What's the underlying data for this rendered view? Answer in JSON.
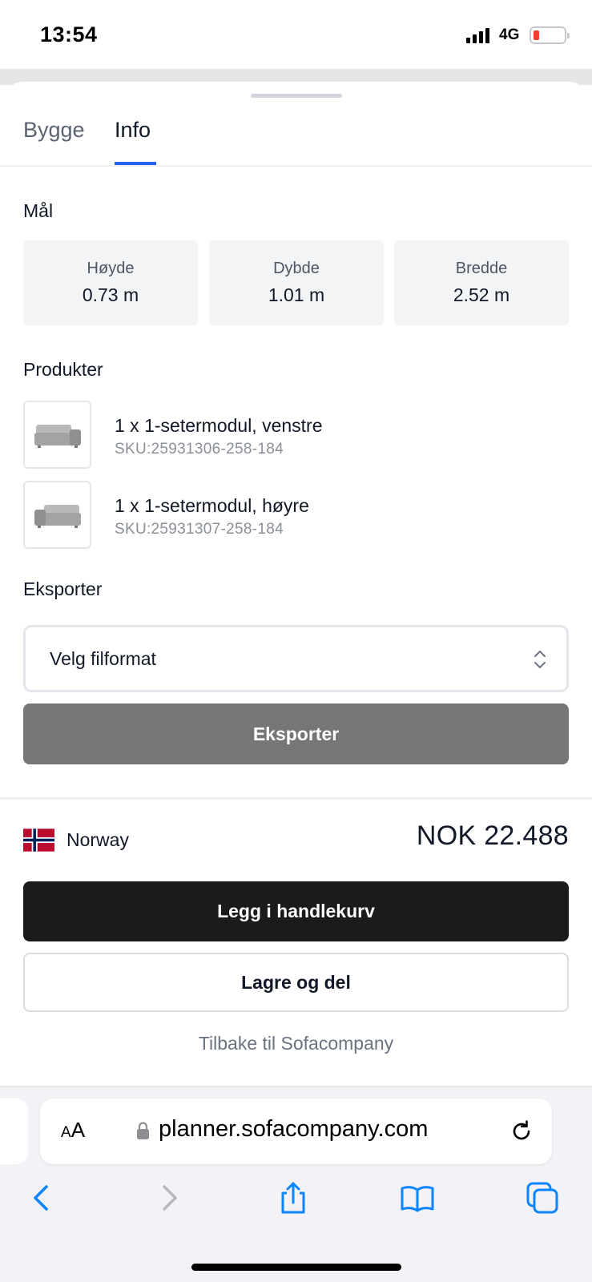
{
  "status_bar": {
    "time": "13:54",
    "network": "4G"
  },
  "tabs": [
    {
      "label": "Bygge"
    },
    {
      "label": "Info"
    }
  ],
  "dimensions": {
    "title": "Mål",
    "items": [
      {
        "label": "Høyde",
        "value": "0.73 m"
      },
      {
        "label": "Dybde",
        "value": "1.01 m"
      },
      {
        "label": "Bredde",
        "value": "2.52 m"
      }
    ]
  },
  "products": {
    "title": "Produkter",
    "items": [
      {
        "name": "1 x 1-setermodul, venstre",
        "sku": "SKU:25931306-258-184"
      },
      {
        "name": "1 x 1-setermodul, høyre",
        "sku": "SKU:25931307-258-184"
      }
    ]
  },
  "export": {
    "title": "Eksporter",
    "select_value": "Velg filformat",
    "button_label": "Eksporter"
  },
  "summary": {
    "country": "Norway",
    "price": "NOK 22.488",
    "add_to_cart_label": "Legg i handlekurv",
    "save_share_label": "Lagre og del",
    "back_link": "Tilbake til Sofacompany"
  },
  "browser": {
    "text_size_label_big": "A",
    "text_size_label_small": "A",
    "url": "planner.sofacompany.com"
  },
  "colors": {
    "accent": "#2563eb",
    "export_button": "#767676",
    "cart_button": "#1b1b1b",
    "ios_blue": "#0a84ff",
    "battery_low": "#ff3b30"
  }
}
